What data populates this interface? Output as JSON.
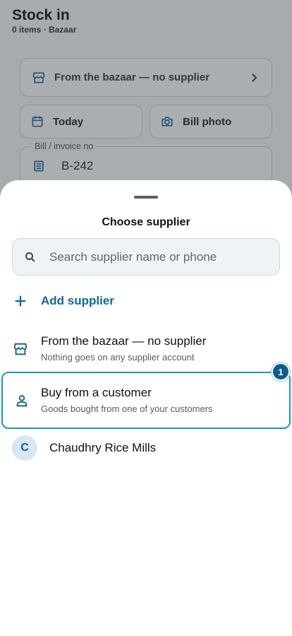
{
  "screen": {
    "title": "Stock in",
    "subtitle": "0 items · Bazaar"
  },
  "form": {
    "supplier_label": "From the bazaar — no supplier",
    "date_label": "Today",
    "bill_photo_label": "Bill photo",
    "invoice_legend": "Bill / invoice no",
    "invoice_value": "B-242"
  },
  "sheet": {
    "title": "Choose supplier",
    "search_placeholder": "Search supplier name or phone",
    "search_value": "",
    "add_label": "Add supplier",
    "options": [
      {
        "title": "From the bazaar — no supplier",
        "subtitle": "Nothing goes on any supplier account",
        "icon": "store-icon"
      },
      {
        "title": "Buy from a customer",
        "subtitle": "Goods bought from one of your customers",
        "icon": "person-icon"
      }
    ],
    "highlight_badge": "1",
    "contacts": [
      {
        "initial": "C",
        "name": "Chaudhry Rice Mills"
      }
    ]
  },
  "colors": {
    "accent": "#0b6aa2",
    "highlight_border": "#1c95cf",
    "badge": "#0c5e8c",
    "avatar_bg": "#d6e8f3"
  }
}
